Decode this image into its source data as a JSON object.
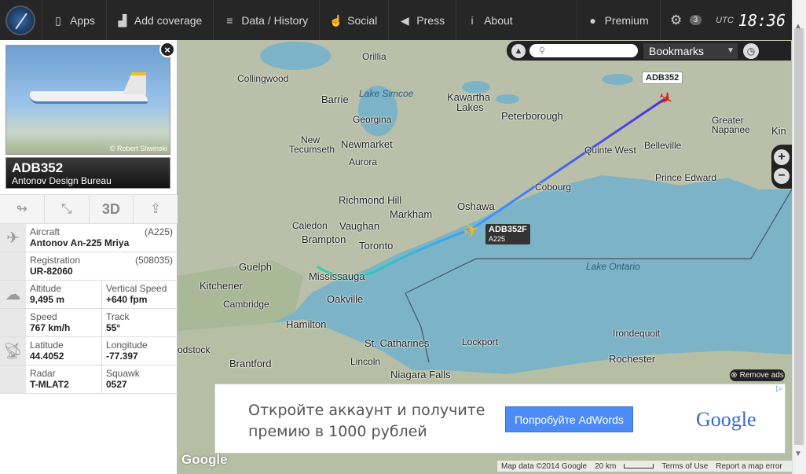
{
  "nav": {
    "items": [
      {
        "label": "Apps",
        "icon": "phone-icon"
      },
      {
        "label": "Add coverage",
        "icon": "signal-icon"
      },
      {
        "label": "Data / History",
        "icon": "database-icon"
      },
      {
        "label": "Social",
        "icon": "thumbs-up-icon"
      },
      {
        "label": "Press",
        "icon": "megaphone-icon"
      },
      {
        "label": "About",
        "icon": "info-icon"
      }
    ],
    "premium_label": "Premium",
    "settings_badge": "3",
    "utc_label": "UTC",
    "clock": "18:36"
  },
  "flight": {
    "photo_credit": "© Robert Sliwinski",
    "callsign": "ADB352",
    "operator": "Antonov Design Bureau",
    "tools": {
      "three_d_label": "3D"
    },
    "aircraft_label": "Aircraft",
    "aircraft_value": "Antonov An-225 Mriya",
    "aircraft_code": "(A225)",
    "registration_label": "Registration",
    "registration_value": "UR-82060",
    "registration_code": "(508035)",
    "altitude_label": "Altitude",
    "altitude_value": "9,495 m",
    "vspeed_label": "Vertical Speed",
    "vspeed_value": "+640 fpm",
    "speed_label": "Speed",
    "speed_value": "767 km/h",
    "track_label": "Track",
    "track_value": "55°",
    "latitude_label": "Latitude",
    "latitude_value": "44.4052",
    "longitude_label": "Longitude",
    "longitude_value": "-77.397",
    "radar_label": "Radar",
    "radar_value": "T-MLAT2",
    "squawk_label": "Squawk",
    "squawk_value": "0527"
  },
  "map": {
    "bookmarks_label": "Bookmarks",
    "search_placeholder": "",
    "labels": {
      "orillia": "Orillia",
      "collingwood": "Collingwood",
      "barrie": "Barrie",
      "lake_simcoe": "Lake Simcoe",
      "kawartha": "Kawartha",
      "lakes": "Lakes",
      "peterborough": "Peterborough",
      "georgina": "Georgina",
      "new": "New",
      "tecumseth": "Tecumseth",
      "newmarket": "Newmarket",
      "aurora": "Aurora",
      "greater": "Greater",
      "napanee": "Napanee",
      "kingston": "Kin",
      "belleville": "Belleville",
      "quinte_west": "Quinte West",
      "prince_edward": "Prince Edward",
      "cobourg": "Cobourg",
      "richmond_hill": "Richmond Hill",
      "oshawa": "Oshawa",
      "markham": "Markham",
      "caledon": "Caledon",
      "vaughan": "Vaughan",
      "brampton": "Brampton",
      "toronto": "Toronto",
      "guelph": "Guelph",
      "mississauga": "Mississauga",
      "kitchener": "Kitchener",
      "cambridge": "Cambridge",
      "oakville": "Oakville",
      "lake_ontario": "Lake Ontario",
      "hamilton": "Hamilton",
      "brantford": "Brantford",
      "st_catharines": "St. Catharines",
      "lockport": "Lockport",
      "lincoln": "Lincoln",
      "niagara_falls": "Niagara Falls",
      "irondequoit": "Irondequoit",
      "rochester": "Rochester",
      "odstock": "odstock"
    },
    "origin_tag": "ADB352",
    "flight_tag": "ADB352F",
    "flight_tag_type": "A225",
    "remove_ads": "Remove ads",
    "footer": {
      "map_data": "Map data ©2014 Google",
      "scale": "20 km",
      "terms": "Terms of Use",
      "report": "Report a map error"
    },
    "google_logo": "Google"
  },
  "ad": {
    "text_line1": "Откройте аккаунт и получите",
    "text_line2": "премию в 1000 рублей",
    "button": "Попробуйте AdWords",
    "logo": "Google"
  },
  "colors": {
    "track_start": "#2bd6a0",
    "track_mid": "#3aa0ff",
    "track_end": "#5030d0",
    "plane": "#f5b51c",
    "origin_plane": "#d62020"
  }
}
